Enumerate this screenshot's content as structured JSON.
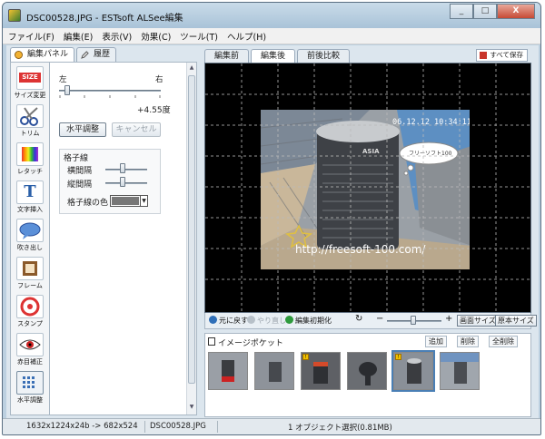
{
  "window": {
    "title": "DSC00528.JPG - ESTsoft ALSee編集",
    "buttons": {
      "minimize": "_",
      "maximize": "□",
      "close": "X"
    }
  },
  "menu": [
    "ファイル(F)",
    "編集(E)",
    "表示(V)",
    "効果(C)",
    "ツール(T)",
    "ヘルプ(H)"
  ],
  "left_panel": {
    "tabs": [
      "編集パネル",
      "履歴"
    ],
    "tools": [
      {
        "label": "サイズ変更",
        "icon": "size-icon",
        "icon_text": "SIZE"
      },
      {
        "label": "トリム",
        "icon": "scissors-icon"
      },
      {
        "label": "レタッチ",
        "icon": "retouch-icon"
      },
      {
        "label": "文字挿入",
        "icon": "text-insert-icon",
        "icon_text": "T"
      },
      {
        "label": "吹き出し",
        "icon": "speech-bubble-icon"
      },
      {
        "label": "フレーム",
        "icon": "frame-icon"
      },
      {
        "label": "スタンプ",
        "icon": "stamp-icon"
      },
      {
        "label": "赤目補正",
        "icon": "red-eye-icon"
      },
      {
        "label": "水平調整",
        "icon": "level-icon"
      }
    ],
    "level": {
      "left_label": "左",
      "right_label": "右",
      "angle": "+4.55度",
      "apply": "水平調整",
      "cancel": "キャンセル"
    },
    "grid": {
      "title": "格子線",
      "horizontal": "横間隔",
      "vertical": "縦間隔",
      "color": "格子線の色"
    }
  },
  "right_panel": {
    "tabs": [
      "編集前",
      "編集後",
      "前後比較"
    ],
    "save_all": "すべて保存",
    "photo": {
      "timestamp": "06.12.12 10:34:11",
      "bubble": "フリーソフト100",
      "url": "http://freesoft-100.com/",
      "can_text": "ASIA"
    },
    "toolbar": {
      "undo": "元に戻す",
      "redo": "やり直し",
      "reset": "編集初期化",
      "fit": "画面サイズ",
      "original": "原本サイズ",
      "minus": "−",
      "plus": "+"
    },
    "pocket": {
      "title": "イメージポケット",
      "add": "追加",
      "remove": "削除",
      "remove_all": "全削除"
    }
  },
  "status": {
    "size": "1632x1224x24b -> 682x524",
    "file": "DSC00528.JPG",
    "selection": "1 オブジェクト選択(0.81MB)"
  }
}
